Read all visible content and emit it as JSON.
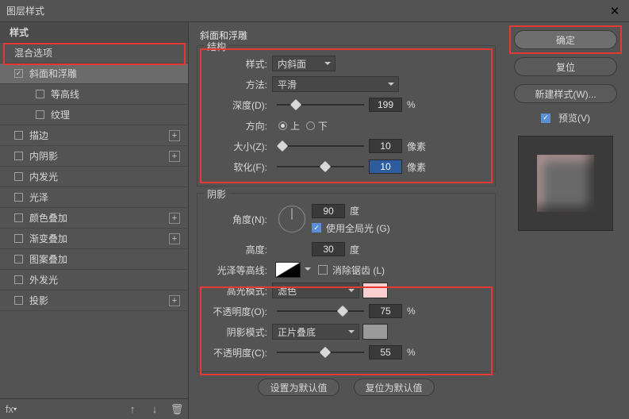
{
  "window": {
    "title": "图层样式"
  },
  "left": {
    "header": "样式",
    "blend": "混合选项",
    "items": [
      {
        "label": "斜面和浮雕",
        "checked": true,
        "sel": true
      },
      {
        "label": "等高线",
        "checked": false,
        "indent": true
      },
      {
        "label": "纹理",
        "checked": false,
        "indent": true
      },
      {
        "label": "描边",
        "checked": false,
        "plus": true
      },
      {
        "label": "内阴影",
        "checked": false,
        "plus": true
      },
      {
        "label": "内发光",
        "checked": false
      },
      {
        "label": "光泽",
        "checked": false
      },
      {
        "label": "颜色叠加",
        "checked": false,
        "plus": true
      },
      {
        "label": "渐变叠加",
        "checked": false,
        "plus": true
      },
      {
        "label": "图案叠加",
        "checked": false
      },
      {
        "label": "外发光",
        "checked": false
      },
      {
        "label": "投影",
        "checked": false,
        "plus": true
      }
    ]
  },
  "bevel": {
    "title": "斜面和浮雕",
    "structure": "结构",
    "style_label": "样式:",
    "style_value": "内斜面",
    "tech_label": "方法:",
    "tech_value": "平滑",
    "depth_label": "深度(D):",
    "depth_value": "199",
    "depth_unit": "%",
    "dir_label": "方向:",
    "dir_up": "上",
    "dir_down": "下",
    "size_label": "大小(Z):",
    "size_value": "10",
    "size_unit": "像素",
    "soften_label": "软化(F):",
    "soften_value": "10",
    "soften_unit": "像素",
    "shade": "阴影",
    "angle_label": "角度(N):",
    "angle_value": "90",
    "deg": "度",
    "global": "使用全局光 (G)",
    "alt_label": "高度:",
    "alt_value": "30",
    "gloss_label": "光泽等高线:",
    "anti": "消除锯齿 (L)",
    "hmode_label": "高光模式:",
    "hmode_value": "滤色",
    "hcolor": "#fccfd0",
    "hop_label": "不透明度(O):",
    "hop_value": "75",
    "pct": "%",
    "smode_label": "阴影模式:",
    "smode_value": "正片叠底",
    "scolor": "#9a9a9a",
    "sop_label": "不透明度(C):",
    "sop_value": "55",
    "make_default": "设置为默认值",
    "reset_default": "复位为默认值"
  },
  "right": {
    "ok": "确定",
    "cancel": "复位",
    "new_style": "新建样式(W)...",
    "preview": "预览(V)"
  }
}
